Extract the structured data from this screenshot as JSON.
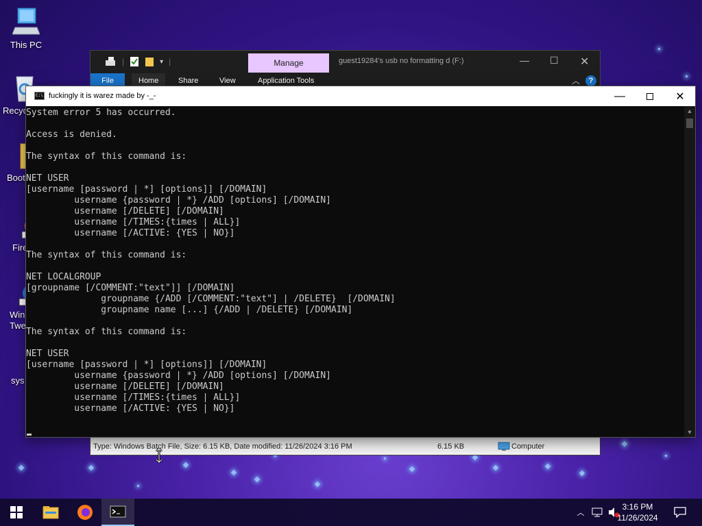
{
  "desktop": {
    "icons": [
      {
        "label": "This PC"
      },
      {
        "label": "Recyc"
      },
      {
        "label": "Boot"
      },
      {
        "label": "Fire"
      },
      {
        "label": "Win"
      },
      {
        "label": "Twe"
      },
      {
        "label": "sys"
      }
    ]
  },
  "explorer": {
    "manage_label": "Manage",
    "path_title": "guest19284's usb no formatting d (F:)",
    "tabs": {
      "file": "File",
      "home": "Home",
      "share": "Share",
      "view": "View",
      "app_tools": "Application Tools"
    },
    "status": {
      "info": "Type: Windows Batch File, Size: 6.15 KB, Date modified: 11/26/2024 3:16 PM",
      "size": "6.15 KB",
      "location": "Computer"
    }
  },
  "console": {
    "title": "fuckingly it is warez made by -_-",
    "lines": [
      "System error 5 has occurred.",
      "",
      "Access is denied.",
      "",
      "The syntax of this command is:",
      "",
      "NET USER",
      "[username [password | *] [options]] [/DOMAIN]",
      "         username {password | *} /ADD [options] [/DOMAIN]",
      "         username [/DELETE] [/DOMAIN]",
      "         username [/TIMES:{times | ALL}]",
      "         username [/ACTIVE: {YES | NO}]",
      "",
      "The syntax of this command is:",
      "",
      "NET LOCALGROUP",
      "[groupname [/COMMENT:\"text\"]] [/DOMAIN]",
      "              groupname {/ADD [/COMMENT:\"text\"] | /DELETE}  [/DOMAIN]",
      "              groupname name [...] {/ADD | /DELETE} [/DOMAIN]",
      "",
      "The syntax of this command is:",
      "",
      "NET USER",
      "[username [password | *] [options]] [/DOMAIN]",
      "         username {password | *} /ADD [options] [/DOMAIN]",
      "         username [/DELETE] [/DOMAIN]",
      "         username [/TIMES:{times | ALL}]",
      "         username [/ACTIVE: {YES | NO}]"
    ]
  },
  "taskbar": {
    "apps": [
      {
        "icon": "windows-start-icon"
      },
      {
        "icon": "file-explorer-icon"
      },
      {
        "icon": "firefox-icon"
      },
      {
        "icon": "command-prompt-icon",
        "active": true
      }
    ],
    "clock": {
      "time": "3:16 PM",
      "date": "11/26/2024"
    }
  }
}
